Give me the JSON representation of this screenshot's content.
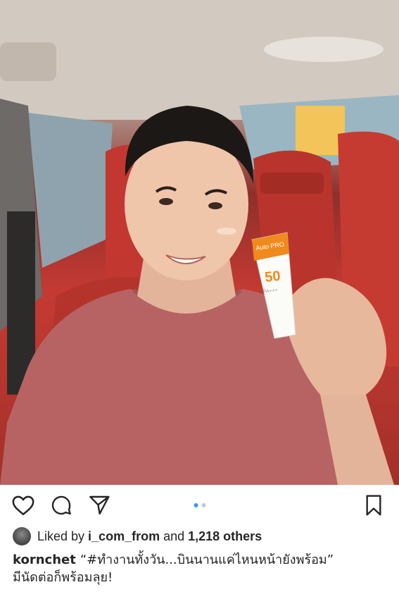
{
  "post": {
    "image_alt": "Man in a red car interior holding up a sunscreen tube",
    "product": {
      "brand": "Auto PRO",
      "spf": "50",
      "subtitle": "PA+++"
    }
  },
  "actions": {
    "like_icon": "heart-icon",
    "comment_icon": "comment-icon",
    "share_icon": "paper-plane-icon",
    "save_icon": "bookmark-icon",
    "carousel": {
      "count": 2,
      "active_index": 0
    }
  },
  "likes": {
    "prefix": "Liked by",
    "user": "i_com_from",
    "joiner": "and",
    "others": "1,218 others"
  },
  "caption": {
    "username": "kornchet",
    "line1": "“#ทำงานทั้งวัน...บินนานแค่ไหนหน้ายังพร้อม”",
    "line2": "มีนัดต่อก็พร้อมลุย!"
  },
  "colors": {
    "accent": "#3897f0",
    "seat_red": "#c43a33",
    "product_orange": "#f08a1c"
  }
}
